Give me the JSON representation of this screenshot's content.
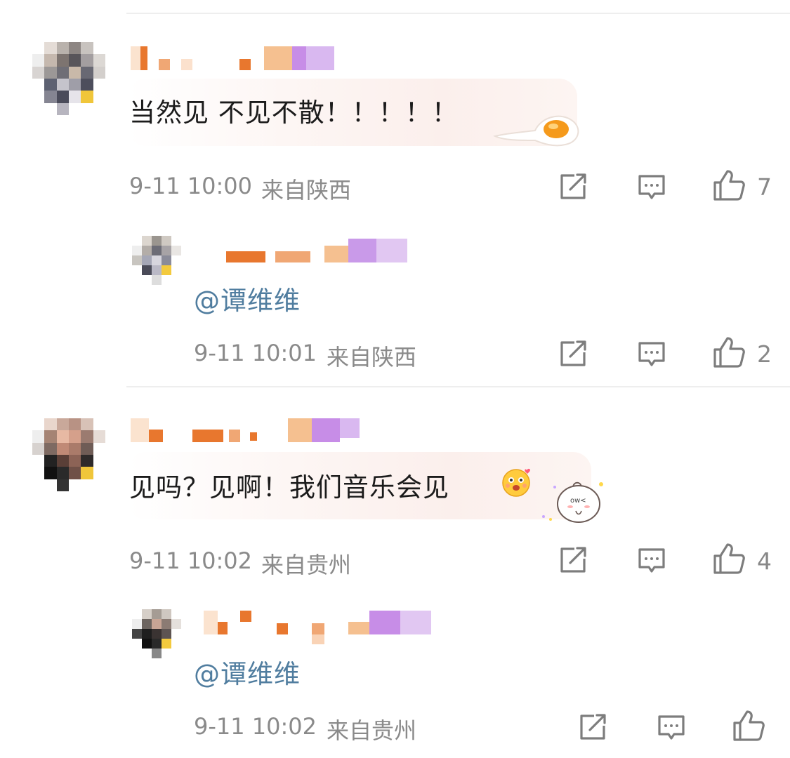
{
  "comments": [
    {
      "text": "当然见 不见不散！！！！！",
      "time": "9-11 10:00",
      "location": "来自陕西",
      "likes": "7",
      "reply": {
        "text": "@谭维维",
        "time": "9-11 10:01",
        "location": "来自陕西",
        "likes": "2"
      }
    },
    {
      "text": "见吗？见啊！我们音乐会见",
      "time": "9-11 10:02",
      "location": "来自贵州",
      "likes": "4",
      "reply": {
        "text": "@谭维维",
        "time": "9-11 10:02",
        "location": "来自贵州",
        "likes": ""
      }
    }
  ],
  "icons": {
    "share": "share-icon",
    "comment": "comment-icon",
    "like": "thumbs-up-icon",
    "egg_sticker": "fried-egg-icon",
    "emoji": "blushing-face-emoji",
    "sticker": "cartoon-bun-sticker"
  },
  "colors": {
    "mention": "#507d9f",
    "meta": "#8a8a8a",
    "name_orange": "#e8772e",
    "name_purple": "#b98ce6"
  }
}
